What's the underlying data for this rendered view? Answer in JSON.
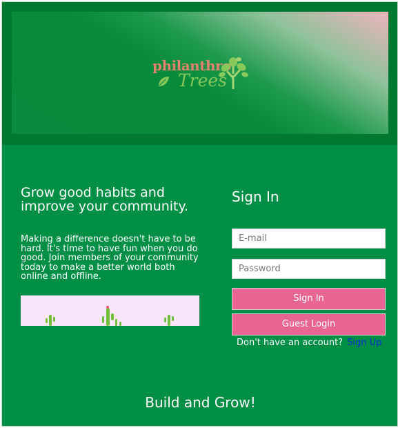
{
  "brand": {
    "logo_line1": "philanthro",
    "logo_line2": "Trees",
    "colors": {
      "primary_green": "#008f45",
      "header_green": "#00782f",
      "accent_pink": "#e86493",
      "link_blue": "#0b2ad6"
    }
  },
  "intro": {
    "headline": "Grow good habits and improve your community.",
    "description": "Making a difference doesn't have to be hard. It's time to have fun when you do good. Join members of your community today to make a better world both online and offline."
  },
  "signin": {
    "title": "Sign In",
    "email_placeholder": "E-mail",
    "password_placeholder": "Password",
    "signin_button": "Sign In",
    "guest_button": "Guest Login",
    "no_account_text": "Don't have an account?",
    "signup_link": "Sign Up"
  },
  "footer": {
    "slogan": "Build and Grow!"
  },
  "icons": [
    "leaf-icon",
    "tree-icon",
    "cactus-icon"
  ]
}
